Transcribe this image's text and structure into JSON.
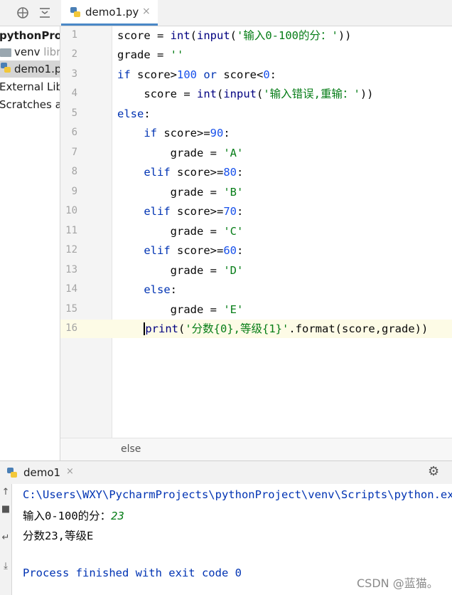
{
  "toolbar": {
    "icons": [
      "globe-icon",
      "collapse-icon"
    ]
  },
  "editor_tab": {
    "label": "demo1.py",
    "close": "×"
  },
  "project": {
    "items": [
      {
        "label": "pythonProj"
      },
      {
        "label": "venv",
        "hint": "libr"
      },
      {
        "label": "demo1.p"
      },
      {
        "label": "External Lib"
      },
      {
        "label": "Scratches an"
      }
    ]
  },
  "line_numbers": [
    "1",
    "2",
    "3",
    "4",
    "5",
    "6",
    "7",
    "8",
    "9",
    "10",
    "11",
    "12",
    "13",
    "14",
    "15",
    "16"
  ],
  "code": {
    "l1": {
      "a": "score = ",
      "b": "int",
      "c": "(",
      "d": "input",
      "e": "(",
      "f": "'输入0-100的分：'",
      "g": "))"
    },
    "l2": {
      "a": "grade = ",
      "b": "''"
    },
    "l3": {
      "a": "if",
      "b": " score>",
      "c": "100",
      "d": " or",
      "e": " score<",
      "f": "0",
      "g": ":"
    },
    "l4": {
      "a": "    score = ",
      "b": "int",
      "c": "(",
      "d": "input",
      "e": "(",
      "f": "'输入错误,重输：'",
      "g": "))"
    },
    "l5": {
      "a": "else",
      "b": ":"
    },
    "l6": {
      "a": "    if",
      "b": " score>=",
      "c": "90",
      "d": ":"
    },
    "l7": {
      "a": "        grade = ",
      "b": "'A'"
    },
    "l8": {
      "a": "    elif",
      "b": " score>=",
      "c": "80",
      "d": ":"
    },
    "l9": {
      "a": "        grade = ",
      "b": "'B'"
    },
    "l10": {
      "a": "    elif",
      "b": " score>=",
      "c": "70",
      "d": ":"
    },
    "l11": {
      "a": "        grade = ",
      "b": "'C'"
    },
    "l12": {
      "a": "    elif",
      "b": " score>=",
      "c": "60",
      "d": ":"
    },
    "l13": {
      "a": "        grade = ",
      "b": "'D'"
    },
    "l14": {
      "a": "    else",
      "b": ":"
    },
    "l15": {
      "a": "        grade = ",
      "b": "'E'"
    },
    "l16": {
      "a": "    ",
      "b": "print",
      "c": "(",
      "d": "'分数{0},等级{1}'",
      "e": ".format(score,grade))"
    }
  },
  "breadcrumb": "else",
  "run": {
    "tab_label": "demo1",
    "close": "×",
    "console": {
      "command": "C:\\Users\\WXY\\PycharmProjects\\pythonProject\\venv\\Scripts\\python.exe",
      "prompt": "输入0-100的分：",
      "input_value": "23",
      "output": "分数23,等级E",
      "exit": "Process finished with exit code 0"
    }
  },
  "watermark": "CSDN @蓝猫。",
  "colors": {
    "keyword": "#0033b3",
    "number": "#1750eb",
    "string": "#067d17",
    "builtin": "#000080",
    "console_command": "#0033b3",
    "console_input": "#067d17"
  }
}
